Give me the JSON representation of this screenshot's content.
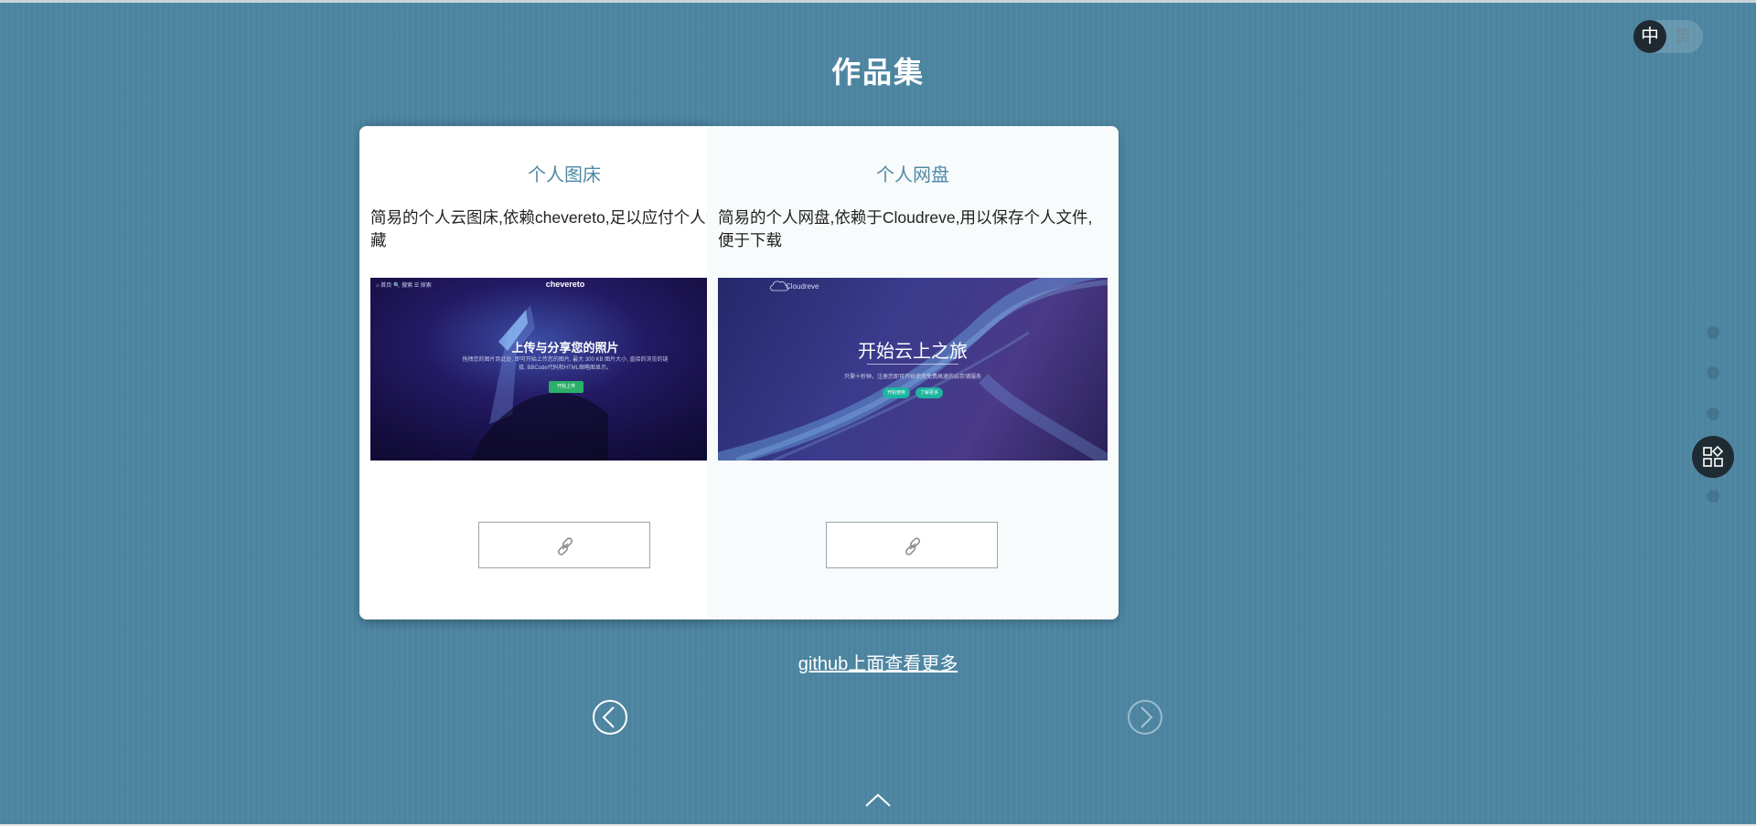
{
  "language": {
    "zh_label": "中",
    "en_label": "英"
  },
  "page_title": "作品集",
  "cards": [
    {
      "title": "个人图床",
      "description": "简易的个人云图床,依赖chevereto,足以应付个人分类收藏",
      "screenshot": {
        "nav": "⌂ 首页  🔍 搜索  ☰ 探索",
        "brand": "chevereto",
        "heading": "上传与分享您的照片",
        "subtext": "拖拽您的图片到此处, 即可开始上传您的图片, 最大 300 KB 图片大小, 直接的浏览的链接, BBCode代码和HTML缩略图显示。",
        "button": "开始上传"
      },
      "link_icon": "link-icon"
    },
    {
      "title": "个人网盘",
      "description": "简易的个人网盘,依赖于Cloudreve,用以保存个人文件,便于下载",
      "screenshot": {
        "logo": "Cloudreve",
        "heading": "开始云上之旅",
        "subtext": "只需十秒钟，注册您即可开始使用免费高速的云存储服务",
        "button_1": "开始使用",
        "button_2": "了解更多"
      },
      "link_icon": "link-icon"
    }
  ],
  "github_link": "github上面查看更多",
  "nav": {
    "prev_icon": "chevron-left-icon",
    "next_icon": "chevron-right-icon",
    "up_icon": "chevron-up-icon"
  },
  "side_nav": {
    "dots": 5,
    "active_index": 3,
    "fab_icon": "apps-icon"
  },
  "colors": {
    "background": "#4d86a2",
    "card_title": "#4f89a5",
    "fab": "#1f2b32"
  }
}
